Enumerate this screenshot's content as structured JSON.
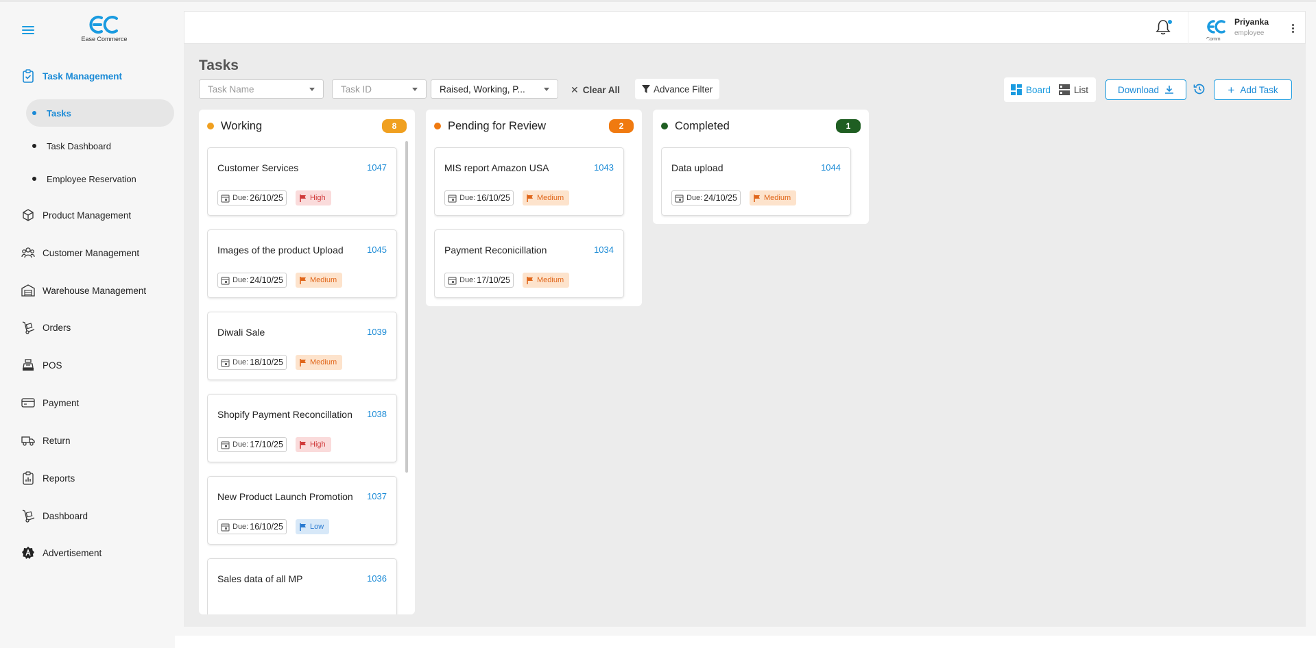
{
  "app": {
    "logo_text": "Ease Commerce"
  },
  "sidebar": {
    "items": [
      {
        "label": "Task Management",
        "icon": "clipboard-check-icon",
        "active": true
      },
      {
        "label": "Product Management",
        "icon": "cube-icon"
      },
      {
        "label": "Customer Management",
        "icon": "users-icon"
      },
      {
        "label": "Warehouse Management",
        "icon": "warehouse-icon"
      },
      {
        "label": "Orders",
        "icon": "hand-truck-icon"
      },
      {
        "label": "POS",
        "icon": "pos-terminal-icon"
      },
      {
        "label": "Payment",
        "icon": "credit-card-icon"
      },
      {
        "label": "Return",
        "icon": "truck-icon"
      },
      {
        "label": "Reports",
        "icon": "report-clipboard-icon"
      },
      {
        "label": "Dashboard",
        "icon": "hand-truck-icon"
      },
      {
        "label": "Advertisement",
        "icon": "ad-badge-icon"
      }
    ],
    "sub_items": [
      {
        "label": "Tasks",
        "active": true
      },
      {
        "label": "Task Dashboard"
      },
      {
        "label": "Employee Reservation"
      }
    ]
  },
  "header": {
    "user_name": "Priyanka",
    "user_role": "employee",
    "avatar_text": "Comm"
  },
  "page": {
    "title": "Tasks",
    "filters": {
      "task_name_placeholder": "Task Name",
      "task_id_placeholder": "Task ID",
      "status_value": "Raised, Working, P...",
      "clear_all": "Clear All",
      "advance_filter": "Advance Filter"
    },
    "view": {
      "board": "Board",
      "list": "List",
      "selected": "Board"
    },
    "download": "Download",
    "add_task": "Add Task"
  },
  "colors": {
    "accent": "#1a9be0",
    "working": "#f0a020",
    "pending": "#f07a10",
    "completed": "#1f5e22",
    "high": "#d03a3a",
    "medium": "#e0661a",
    "low": "#2a7ad0"
  },
  "board": {
    "columns": [
      {
        "title": "Working",
        "count": "8",
        "cards": [
          {
            "title": "Customer Services",
            "id": "1047",
            "due_label": "Due:",
            "due": "26/10/25",
            "priority": "High"
          },
          {
            "title": "Images of the product Upload",
            "id": "1045",
            "due_label": "Due:",
            "due": "24/10/25",
            "priority": "Medium"
          },
          {
            "title": "Diwali Sale",
            "id": "1039",
            "due_label": "Due:",
            "due": "18/10/25",
            "priority": "Medium"
          },
          {
            "title": "Shopify Payment Reconcillation",
            "id": "1038",
            "due_label": "Due:",
            "due": "17/10/25",
            "priority": "High"
          },
          {
            "title": "New Product Launch Promotion",
            "id": "1037",
            "due_label": "Due:",
            "due": "16/10/25",
            "priority": "Low"
          },
          {
            "title": "Sales data of all MP",
            "id": "1036",
            "due_label": "",
            "due": "",
            "priority": ""
          }
        ]
      },
      {
        "title": "Pending for Review",
        "count": "2",
        "cards": [
          {
            "title": "MIS report Amazon USA",
            "id": "1043",
            "due_label": "Due:",
            "due": "16/10/25",
            "priority": "Medium"
          },
          {
            "title": "Payment Reconicillation",
            "id": "1034",
            "due_label": "Due:",
            "due": "17/10/25",
            "priority": "Medium"
          }
        ]
      },
      {
        "title": "Completed",
        "count": "1",
        "cards": [
          {
            "title": "Data upload",
            "id": "1044",
            "due_label": "Due:",
            "due": "24/10/25",
            "priority": "Medium"
          }
        ]
      }
    ]
  }
}
